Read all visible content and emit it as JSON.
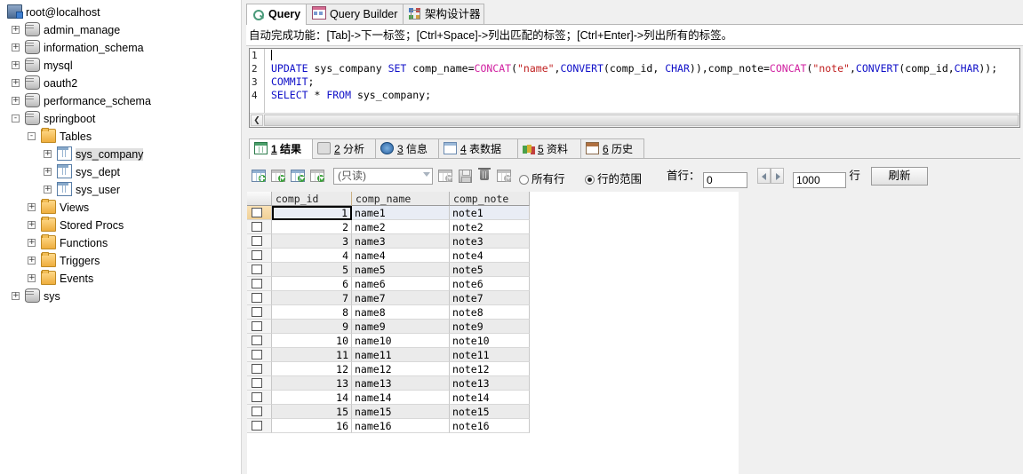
{
  "tree": {
    "root": {
      "label": "root@localhost",
      "icon": "server-icon"
    },
    "items": [
      {
        "label": "admin_manage",
        "icon": "database-icon",
        "indent": 0,
        "expander": "+"
      },
      {
        "label": "information_schema",
        "icon": "database-icon",
        "indent": 0,
        "expander": "+"
      },
      {
        "label": "mysql",
        "icon": "database-icon",
        "indent": 0,
        "expander": "+"
      },
      {
        "label": "oauth2",
        "icon": "database-icon",
        "indent": 0,
        "expander": "+"
      },
      {
        "label": "performance_schema",
        "icon": "database-icon",
        "indent": 0,
        "expander": "+"
      },
      {
        "label": "springboot",
        "icon": "database-icon",
        "indent": 0,
        "expander": "-"
      },
      {
        "label": "Tables",
        "icon": "folder-icon",
        "indent": 1,
        "expander": "-"
      },
      {
        "label": "sys_company",
        "icon": "table-icon",
        "indent": 2,
        "expander": "+",
        "selected": true
      },
      {
        "label": "sys_dept",
        "icon": "table-icon",
        "indent": 2,
        "expander": "+"
      },
      {
        "label": "sys_user",
        "icon": "table-icon",
        "indent": 2,
        "expander": "+"
      },
      {
        "label": "Views",
        "icon": "folder-icon",
        "indent": 1,
        "expander": "+"
      },
      {
        "label": "Stored Procs",
        "icon": "folder-icon",
        "indent": 1,
        "expander": "+"
      },
      {
        "label": "Functions",
        "icon": "folder-icon",
        "indent": 1,
        "expander": "+"
      },
      {
        "label": "Triggers",
        "icon": "folder-icon",
        "indent": 1,
        "expander": "+"
      },
      {
        "label": "Events",
        "icon": "folder-icon",
        "indent": 1,
        "expander": "+"
      },
      {
        "label": "sys",
        "icon": "database-icon",
        "indent": 0,
        "expander": "+"
      }
    ]
  },
  "tabs": [
    {
      "label": "Query",
      "icon": "query-icon",
      "active": true
    },
    {
      "label": "Query Builder",
      "icon": "query-builder-icon",
      "active": false
    },
    {
      "label": "架构设计器",
      "icon": "schema-designer-icon",
      "active": false
    }
  ],
  "hint": "自动完成功能：[Tab]->下一标签；[Ctrl+Space]->列出匹配的标签；[Ctrl+Enter]->列出所有的标签。",
  "editor": {
    "line_numbers": [
      "1",
      "2",
      "3",
      "4"
    ],
    "lines": [
      "",
      "UPDATE sys_company SET comp_name=CONCAT(\"name\",CONVERT(comp_id, CHAR)),comp_note=CONCAT(\"note\",CONVERT(comp_id,CHAR));",
      "COMMIT;",
      "SELECT * FROM sys_company;"
    ]
  },
  "result_tabs": [
    {
      "num": "1",
      "label": "结果",
      "icon": "result-grid-icon",
      "active": true
    },
    {
      "num": "2",
      "label": "分析",
      "icon": "profile-icon",
      "active": false
    },
    {
      "num": "3",
      "label": "信息",
      "icon": "info-icon",
      "active": false
    },
    {
      "num": "4",
      "label": "表数据",
      "icon": "table-data-icon",
      "active": false
    },
    {
      "num": "5",
      "label": "资料",
      "icon": "status-icon",
      "active": false
    },
    {
      "num": "6",
      "label": "历史",
      "icon": "history-icon",
      "active": false
    }
  ],
  "data_toolbar": {
    "icons": [
      {
        "name": "add-record-icon",
        "enabled": true
      },
      {
        "name": "export-grid-icon",
        "enabled": true
      },
      {
        "name": "import-grid-icon",
        "enabled": true
      },
      {
        "name": "duplicate-grid-icon",
        "enabled": true
      },
      {
        "name": "insert-row-icon",
        "enabled": false
      },
      {
        "name": "save-record-icon",
        "enabled": false
      },
      {
        "name": "delete-record-icon",
        "enabled": false
      },
      {
        "name": "refresh-grid-icon",
        "enabled": false
      }
    ],
    "mode_select": {
      "value": "(只读)"
    },
    "radio_all_rows": {
      "label": "所有行",
      "selected": false
    },
    "radio_row_range": {
      "label": "行的范围",
      "selected": true
    },
    "first_row_label": "首行：",
    "first_row_value": "0",
    "row_count_value": "1000",
    "rows_unit": "行",
    "refresh_label": "刷新"
  },
  "grid": {
    "columns": [
      "comp_id",
      "comp_name",
      "comp_note"
    ],
    "rows": [
      {
        "comp_id": "1",
        "comp_name": "name1",
        "comp_note": "note1",
        "selected": true
      },
      {
        "comp_id": "2",
        "comp_name": "name2",
        "comp_note": "note2"
      },
      {
        "comp_id": "3",
        "comp_name": "name3",
        "comp_note": "note3"
      },
      {
        "comp_id": "4",
        "comp_name": "name4",
        "comp_note": "note4"
      },
      {
        "comp_id": "5",
        "comp_name": "name5",
        "comp_note": "note5"
      },
      {
        "comp_id": "6",
        "comp_name": "name6",
        "comp_note": "note6"
      },
      {
        "comp_id": "7",
        "comp_name": "name7",
        "comp_note": "note7"
      },
      {
        "comp_id": "8",
        "comp_name": "name8",
        "comp_note": "note8"
      },
      {
        "comp_id": "9",
        "comp_name": "name9",
        "comp_note": "note9"
      },
      {
        "comp_id": "10",
        "comp_name": "name10",
        "comp_note": "note10"
      },
      {
        "comp_id": "11",
        "comp_name": "name11",
        "comp_note": "note11"
      },
      {
        "comp_id": "12",
        "comp_name": "name12",
        "comp_note": "note12"
      },
      {
        "comp_id": "13",
        "comp_name": "name13",
        "comp_note": "note13"
      },
      {
        "comp_id": "14",
        "comp_name": "name14",
        "comp_note": "note14"
      },
      {
        "comp_id": "15",
        "comp_name": "name15",
        "comp_note": "note15"
      },
      {
        "comp_id": "16",
        "comp_name": "name16",
        "comp_note": "note16"
      }
    ]
  }
}
